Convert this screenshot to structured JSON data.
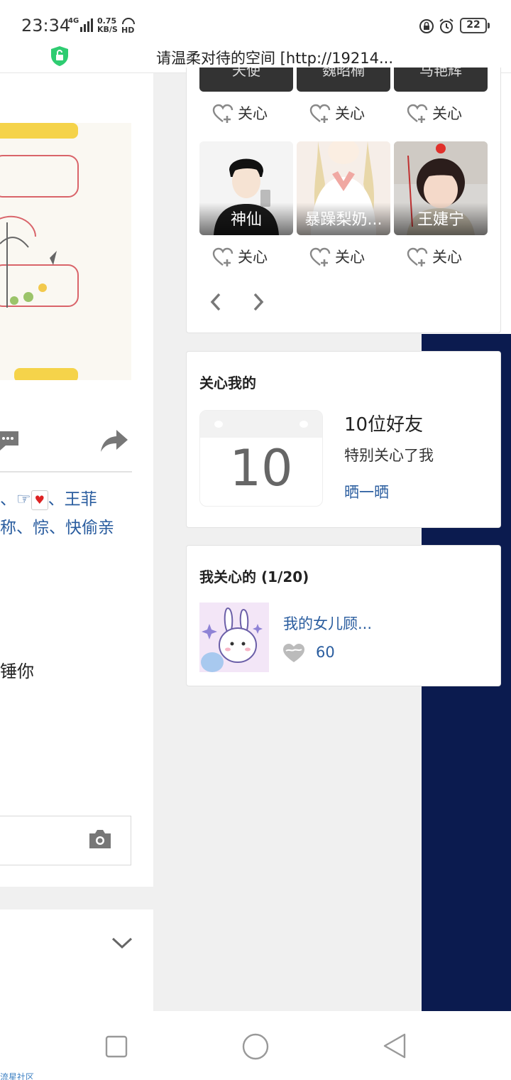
{
  "status_bar": {
    "time": "23:34",
    "network": "4G",
    "speed_value": "0.75",
    "speed_unit": "KB/S",
    "hd": "HD",
    "battery": "22"
  },
  "header": {
    "title": "请温柔对待的空间 [http://19214..."
  },
  "left_column": {
    "liked_by_line1": "、☞",
    "liked_by_line1b": "、王菲",
    "liked_by_line2": "称、悰、快偷亲",
    "comment_text": "锤你"
  },
  "friends_grid": {
    "top_row": [
      "天使",
      "魏昭楠",
      "马艳辉"
    ],
    "care_label": "关心",
    "tiles": [
      {
        "name": "神仙"
      },
      {
        "name": "暴躁梨奶..."
      },
      {
        "name": "王婕宁"
      }
    ]
  },
  "cares_me": {
    "title": "关心我的",
    "calendar_number": "10",
    "count_text": "10位好友",
    "desc": "特别关心了我",
    "show_link": "晒一晒"
  },
  "i_care": {
    "title": "我关心的 (1/20)",
    "item_name": "我的女儿顾...",
    "item_count": "60"
  },
  "footer": {
    "watermark": "流星社区"
  },
  "colors": {
    "link": "#2a5d9f",
    "dark_panel": "#0b1b4f",
    "shield_green": "#2ecc71"
  }
}
